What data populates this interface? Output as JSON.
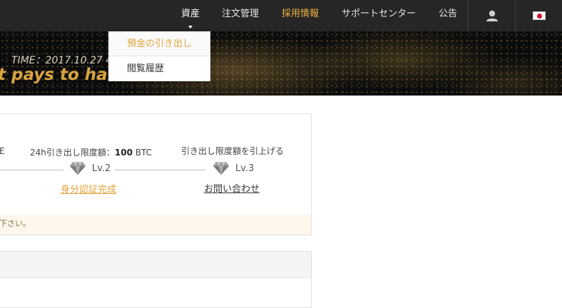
{
  "nav": {
    "items": [
      {
        "label": "資産"
      },
      {
        "label": "注文管理"
      },
      {
        "label": "採用情報"
      },
      {
        "label": "サポートセンター"
      },
      {
        "label": "公告"
      }
    ]
  },
  "dropdown": {
    "items": [
      {
        "label": "預金の引き出し"
      },
      {
        "label": "閲覧履歴"
      }
    ]
  },
  "banner": {
    "time": "TIME：2017.10.27  4",
    "tagline": "t pays to have"
  },
  "limits": {
    "left_fragment": "E",
    "limit_prefix": "24h引き出し限度額：",
    "limit_value": "100",
    "limit_unit": "BTC",
    "raise_label": "引き出し限度額を引上げる",
    "level2": "Lv.2",
    "level3": "Lv.3",
    "verify_link": "身分認証完成",
    "contact_link": "お問い合わせ"
  },
  "notice": {
    "text": "下さい。"
  },
  "colors": {
    "accent": "#e0a43c",
    "nav_bg": "#262626",
    "notice_bg": "#fdf7ee"
  }
}
